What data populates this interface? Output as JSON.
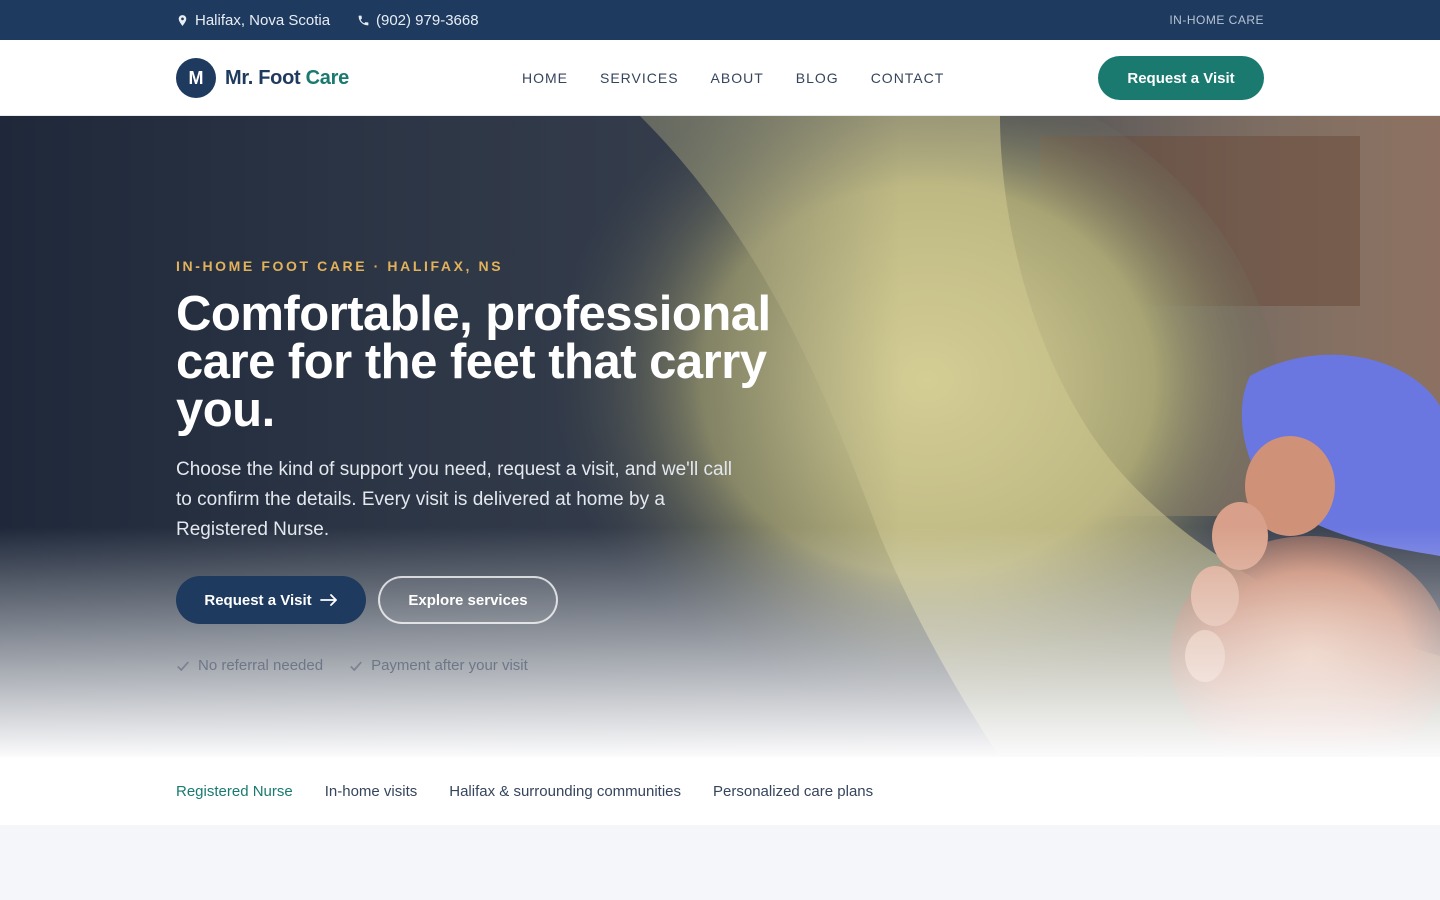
{
  "topbar": {
    "location": "Halifax, Nova Scotia",
    "location_icon": "map-pin-icon",
    "phone": "(902) 979-3668",
    "phone_icon": "phone-icon",
    "tag": "IN-HOME CARE"
  },
  "header": {
    "logo_letter": "M",
    "brand_main": "Mr. Foot ",
    "brand_accent": "Care",
    "nav": [
      "HOME",
      "SERVICES",
      "ABOUT",
      "BLOG",
      "CONTACT"
    ],
    "cta": "Request a Visit"
  },
  "hero": {
    "eyebrow": "IN-HOME FOOT CARE · HALIFAX, NS",
    "headline": "Comfortable, professional care for the feet that carry you.",
    "lede": "Choose the kind of support you need, request a visit, and we'll call to confirm the details. Every visit is delivered at home by a Registered Nurse.",
    "primary_button": "Request a Visit",
    "secondary_button": "Explore services",
    "checks": [
      "No referral needed",
      "Payment after your visit"
    ]
  },
  "features": [
    "Registered Nurse",
    "In-home visits",
    "Halifax & surrounding communities",
    "Personalized care plans"
  ],
  "colors": {
    "navy": "#1e3a5f",
    "teal": "#1a7a70",
    "gold": "#e2b25b"
  }
}
